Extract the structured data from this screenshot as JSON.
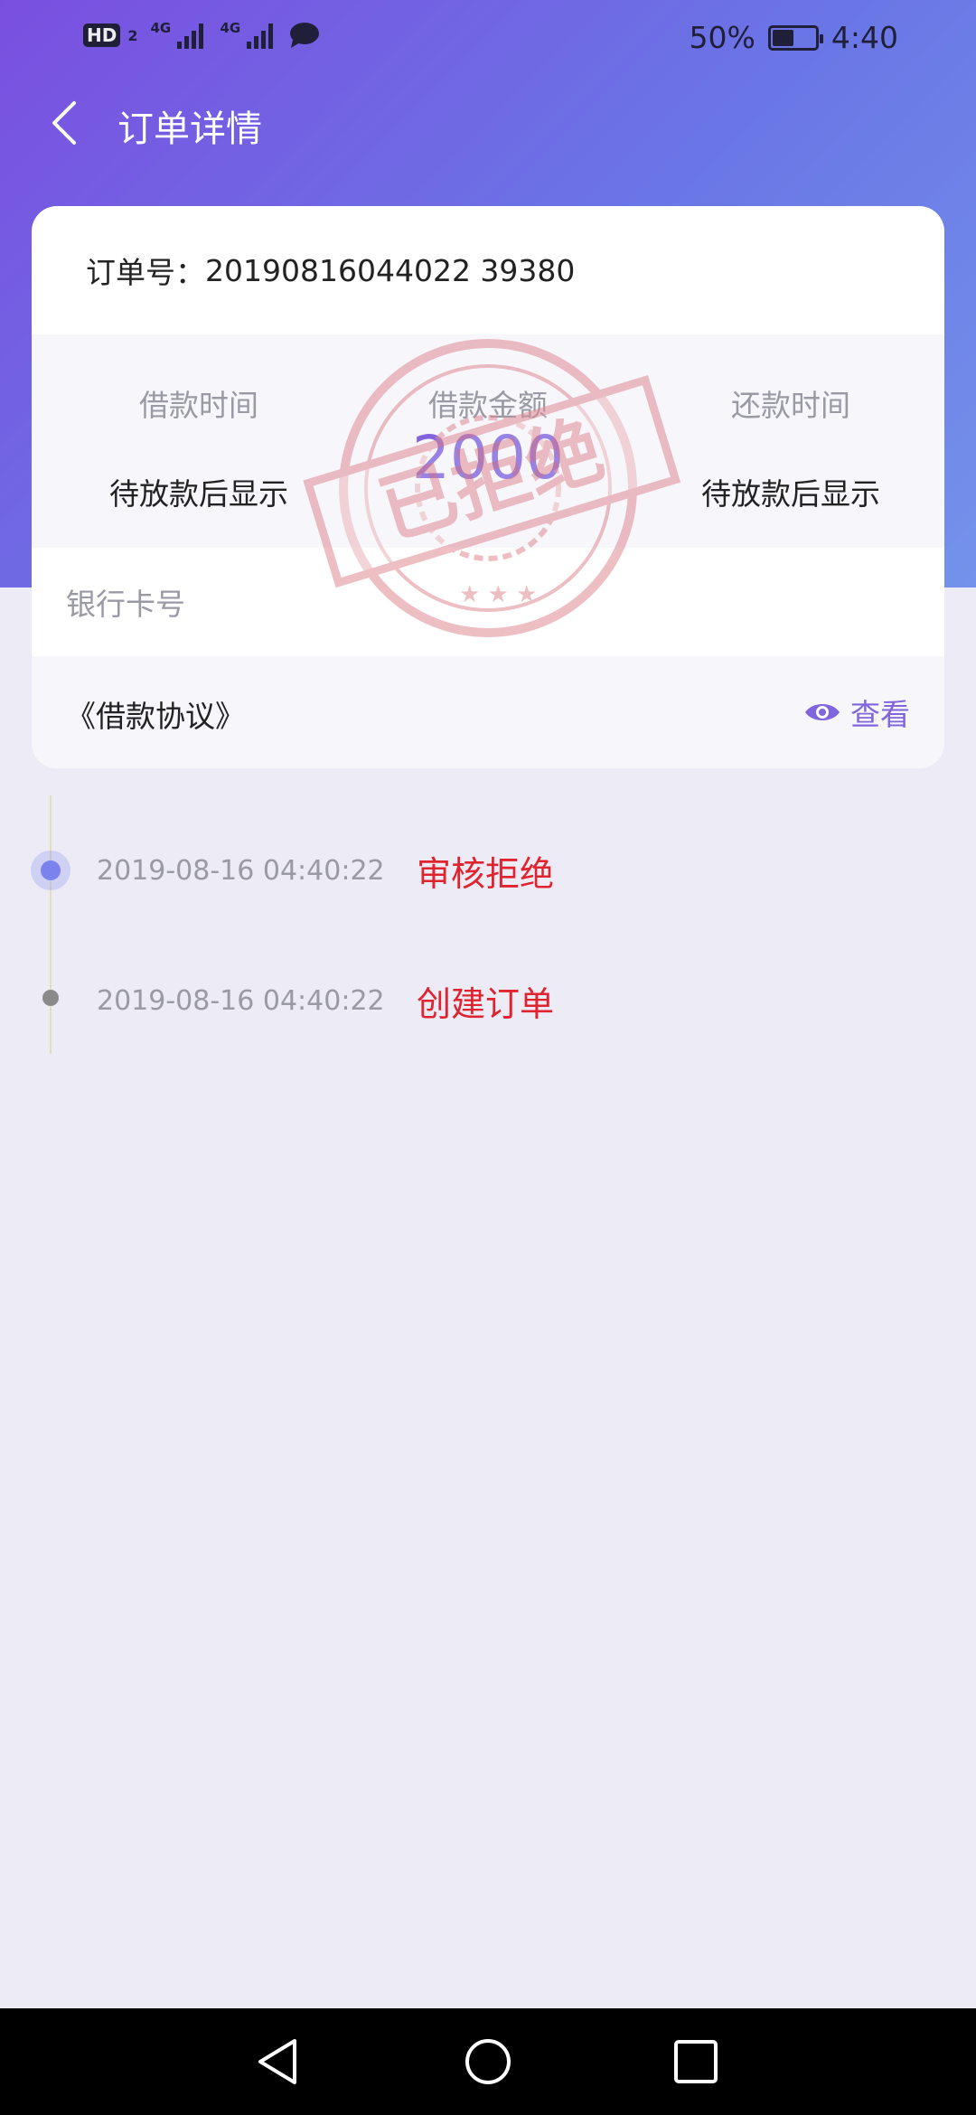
{
  "status_bar": {
    "hd_label": "HD",
    "sim_number": "2",
    "network_1": "4G",
    "network_2": "4G",
    "battery_percent_text": "50%",
    "battery_level": 0.5,
    "time": "4:40"
  },
  "header": {
    "title": "订单详情",
    "background_gradient": [
      "#7a4fe0",
      "#6a76e6",
      "#7492ea"
    ]
  },
  "order": {
    "number_label": "订单号：",
    "number_value": "20190816044022 39380",
    "loan_time_label": "借款时间",
    "loan_time_value": "待放款后显示",
    "loan_amount_label": "借款金额",
    "loan_amount_value": "2000",
    "repay_time_label": "还款时间",
    "repay_time_value": "待放款后显示",
    "bank_card_label": "银行卡号",
    "agreement_label": "《借款协议》",
    "view_label": "查看",
    "stamp_text": "已拒绝"
  },
  "timeline": [
    {
      "time": "2019-08-16 04:40:22",
      "status": "审核拒绝",
      "active": true
    },
    {
      "time": "2019-08-16 04:40:22",
      "status": "创建订单",
      "active": false
    }
  ],
  "colors": {
    "accent": "#8065dd",
    "status_red": "#e0242f",
    "page_bg": "#ecebf6"
  },
  "icons": [
    "back-arrow-icon",
    "eye-icon",
    "nav-back-icon",
    "nav-home-icon",
    "nav-recent-icon",
    "message-icon",
    "battery-icon",
    "signal-icon"
  ]
}
